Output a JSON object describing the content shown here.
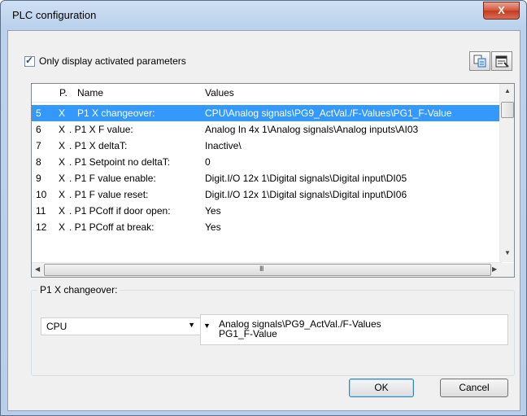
{
  "window": {
    "title": "PLC configuration",
    "close_glyph": "X"
  },
  "filter": {
    "checkbox_label": "Only display activated parameters",
    "checked": true
  },
  "toolbar": {
    "icons": [
      "copy-params-icon",
      "properties-icon"
    ]
  },
  "grid": {
    "columns": [
      "P.",
      "Name",
      "Values"
    ],
    "rows": [
      {
        "num": "5",
        "p": "X",
        "name": "P1 X changeover:",
        "value": "CPU\\Analog signals\\PG9_ActVal./F-Values\\PG1_F-Value",
        "selected": true
      },
      {
        "num": "6",
        "p": "X",
        "name": ". P1 X F value:",
        "value": "Analog In 4x 1\\Analog signals\\Analog inputs\\AI03"
      },
      {
        "num": "7",
        "p": "X",
        "name": ". P1 X deltaT:",
        "value": "Inactive\\"
      },
      {
        "num": "8",
        "p": "X",
        "name": ". P1 Setpoint no deltaT:",
        "value": "0"
      },
      {
        "num": "9",
        "p": "X",
        "name": ". P1 F value enable:",
        "value": "Digit.I/O 12x 1\\Digital signals\\Digital input\\DI05"
      },
      {
        "num": "10",
        "p": "X",
        "name": ". P1 F value reset:",
        "value": "Digit.I/O 12x 1\\Digital signals\\Digital input\\DI06"
      },
      {
        "num": "11",
        "p": "X",
        "name": ". P1 PCoff if door open:",
        "value": "Yes"
      },
      {
        "num": "12",
        "p": "X",
        "name": ". P1 PCoff at break:",
        "value": "Yes"
      }
    ],
    "hscroll_grip": "III"
  },
  "detail": {
    "group_label": "P1 X changeover:",
    "combo_value": "CPU",
    "path_line1": "Analog signals\\PG9_ActVal./F-Values",
    "path_line2": "PG1_F-Value"
  },
  "buttons": {
    "ok": "OK",
    "cancel": "Cancel"
  }
}
